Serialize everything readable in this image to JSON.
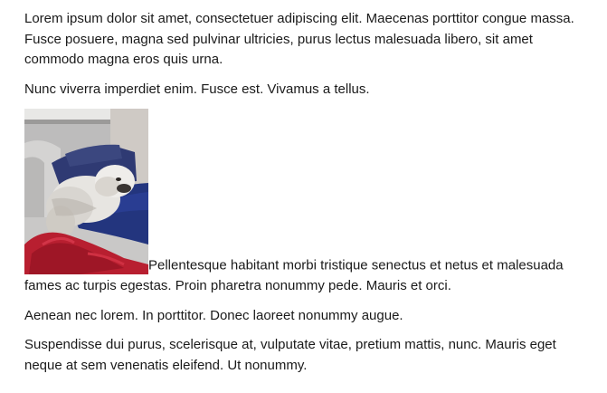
{
  "document": {
    "paragraphs": [
      "Lorem ipsum dolor sit amet, consectetuer adipiscing elit. Maecenas porttitor congue massa. Fusce posuere, magna sed pulvinar ultricies, purus lectus malesuada libero, sit amet commodo magna eros quis urna.",
      "Nunc viverra imperdiet enim. Fusce est. Vivamus a tellus.",
      "Pellentesque habitant morbi tristique senectus et netus et malesuada fames ac turpis egestas. Proin pharetra nonummy pede. Mauris et orci.",
      "Aenean nec lorem. In porttitor. Donec laoreet nonummy augue.",
      "Suspendisse dui purus, scelerisque at, vulputate vitae, pretium mattis, nunc. Mauris eget neque at sem venenatis eleifend. Ut nonummy."
    ]
  }
}
